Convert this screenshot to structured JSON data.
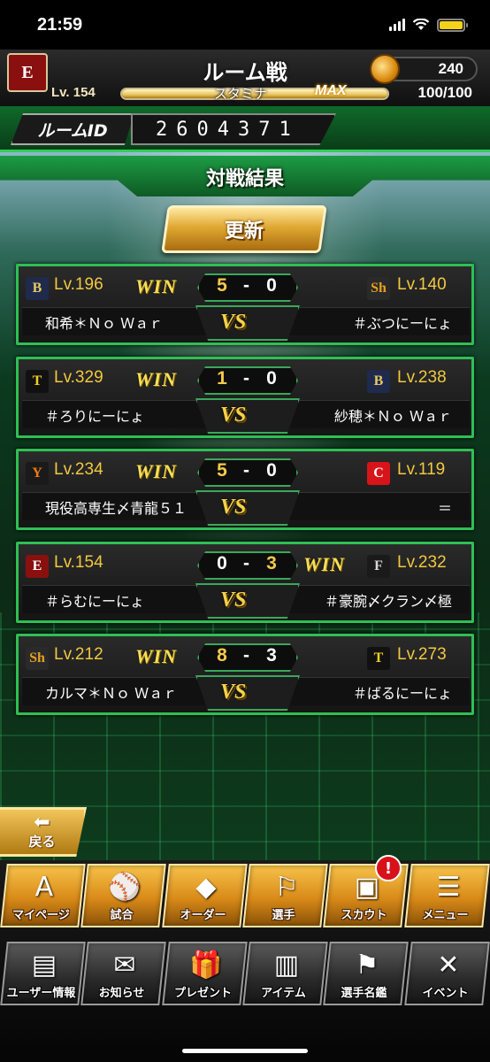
{
  "status": {
    "time": "21:59"
  },
  "header": {
    "title": "ルーム戦",
    "team_badge": "E",
    "coins": "240",
    "level": "Lv. 154",
    "stamina_label": "スタミナ",
    "max_label": "MAX",
    "stamina_value": "100/100",
    "stamina_fraction": 1.0
  },
  "room": {
    "label": "ルームID",
    "id": "2604371"
  },
  "results": {
    "title": "対戦結果",
    "refresh_label": "更新",
    "vs_label": "VS",
    "matches": [
      {
        "left": {
          "logo": "B",
          "logo_bg": "#1f2a4d",
          "logo_fg": "#e8c860",
          "level": "Lv.196",
          "name": "和希＊Ｎｏ Ｗａｒ",
          "score": "5"
        },
        "right": {
          "logo": "Sh",
          "logo_bg": "#2a2a2a",
          "logo_fg": "#e8a020",
          "level": "Lv.140",
          "name": "＃ぶつにーにょ",
          "score": "0"
        },
        "win_side": "left",
        "win_label": "WIN"
      },
      {
        "left": {
          "logo": "T",
          "logo_bg": "#111111",
          "logo_fg": "#f2d020",
          "level": "Lv.329",
          "name": "＃ろりにーにょ",
          "score": "1"
        },
        "right": {
          "logo": "B",
          "logo_bg": "#1f2a4d",
          "logo_fg": "#e8c860",
          "level": "Lv.238",
          "name": "紗穂＊Ｎｏ Ｗａｒ",
          "score": "0"
        },
        "win_side": "left",
        "win_label": "WIN"
      },
      {
        "left": {
          "logo": "Y",
          "logo_bg": "#1a1a1a",
          "logo_fg": "#f07a10",
          "level": "Lv.234",
          "name": "現役高専生〆青龍５１",
          "score": "5"
        },
        "right": {
          "logo": "C",
          "logo_bg": "#d8141a",
          "logo_fg": "#ffffff",
          "level": "Lv.119",
          "name": "＝",
          "score": "0"
        },
        "win_side": "left",
        "win_label": "WIN"
      },
      {
        "left": {
          "logo": "E",
          "logo_bg": "#8a1010",
          "logo_fg": "#ffffff",
          "level": "Lv.154",
          "name": "＃らむにーにょ",
          "score": "0"
        },
        "right": {
          "logo": "F",
          "logo_bg": "#1a1a1a",
          "logo_fg": "#d8d8d8",
          "level": "Lv.232",
          "name": "＃豪腕〆クラン〆極",
          "score": "3"
        },
        "win_side": "right",
        "win_label": "WIN"
      },
      {
        "left": {
          "logo": "Sh",
          "logo_bg": "#2a2a2a",
          "logo_fg": "#e8a020",
          "level": "Lv.212",
          "name": "カルマ＊Ｎｏ Ｗａｒ",
          "score": "8"
        },
        "right": {
          "logo": "T",
          "logo_bg": "#111111",
          "logo_fg": "#f2d020",
          "level": "Lv.273",
          "name": "＃ばるにーにょ",
          "score": "3"
        },
        "win_side": "left",
        "win_label": "WIN"
      }
    ]
  },
  "back_label": "戻る",
  "menu_row1": [
    {
      "label": "マイページ",
      "icon": "A"
    },
    {
      "label": "試合",
      "icon": "⚾"
    },
    {
      "label": "オーダー",
      "icon": "◆"
    },
    {
      "label": "選手",
      "icon": "⚐"
    },
    {
      "label": "スカウト",
      "icon": "▣",
      "badge": "!"
    },
    {
      "label": "メニュー",
      "icon": "☰"
    }
  ],
  "menu_row2": [
    {
      "label": "ユーザー情報",
      "icon": "▤"
    },
    {
      "label": "お知らせ",
      "icon": "✉"
    },
    {
      "label": "プレゼント",
      "icon": "🎁"
    },
    {
      "label": "アイテム",
      "icon": "▥"
    },
    {
      "label": "選手名鑑",
      "icon": "⚑"
    },
    {
      "label": "イベント",
      "icon": "✕"
    }
  ],
  "colors": {
    "accent_green": "#2fbf55",
    "gold": "#f6c94a",
    "winner_score": "#f6c94a"
  }
}
